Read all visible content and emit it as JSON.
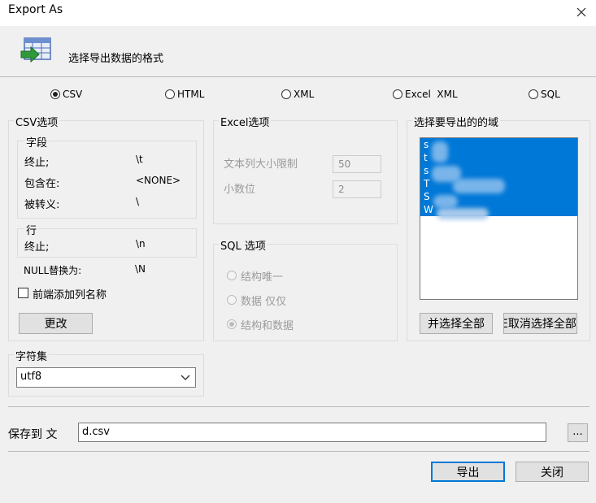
{
  "window": {
    "title": "Export As"
  },
  "header": {
    "text": "选择导出数据的格式"
  },
  "formats": [
    {
      "label": "CSV",
      "selected": true
    },
    {
      "label": "HTML",
      "selected": false
    },
    {
      "label": "XML",
      "selected": false
    },
    {
      "label": "Excel  XML",
      "selected": false
    },
    {
      "label": "SQL",
      "selected": false
    }
  ],
  "csv_options": {
    "title": "CSV选项",
    "fields_group": {
      "title": "字段",
      "rows": [
        {
          "label": "终止;",
          "value": "\\t"
        },
        {
          "label": "包含在:",
          "value": "<NONE>"
        },
        {
          "label": "被转义:",
          "value": "\\"
        }
      ]
    },
    "lines_group": {
      "title": "行",
      "rows": [
        {
          "label": "终止;",
          "value": "\\n"
        }
      ]
    },
    "null_replace": {
      "label": "NULL替换为:",
      "value": "\\N"
    },
    "add_column_names": {
      "label": "前端添加列名称",
      "checked": false
    },
    "change_button": "更改"
  },
  "excel_options": {
    "title": "Excel选项",
    "text_col_limit": {
      "label": "文本列大小限制",
      "value": "50"
    },
    "decimals": {
      "label": "小数位",
      "value": "2"
    }
  },
  "sql_options": {
    "title": "SQL 选项",
    "items": [
      {
        "label": "结构唯一",
        "selected": false
      },
      {
        "label": "数据 仅仅",
        "selected": false
      },
      {
        "label": "结构和数据",
        "selected": true
      }
    ]
  },
  "fields_select": {
    "title": "选择要导出的的域",
    "items": [
      "s",
      "t",
      "s",
      "T",
      "S",
      "W"
    ],
    "select_all_button": "并选择全部",
    "deselect_all_button": "E取消选择全部"
  },
  "charset": {
    "title": "字符集",
    "value": "utf8"
  },
  "save_to": {
    "label": "保存到 文",
    "value": "d.csv",
    "browse_label": "..."
  },
  "buttons": {
    "export": "导出",
    "close": "关闭"
  }
}
